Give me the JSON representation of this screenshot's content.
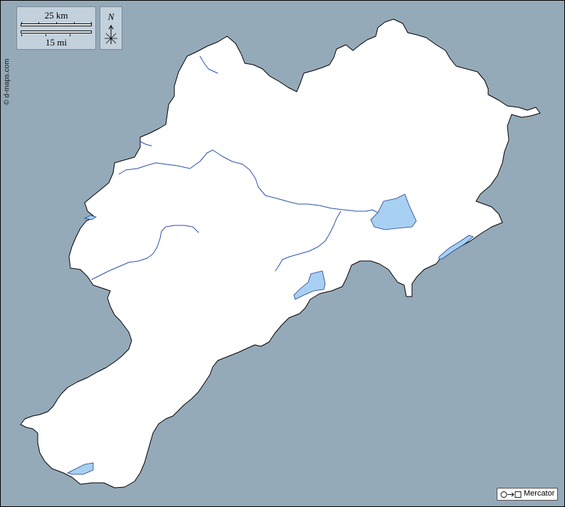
{
  "credit": {
    "text": "© d-maps.com"
  },
  "scale": {
    "km_label": "25 km",
    "mi_label": "15 mi"
  },
  "compass": {
    "north_label": "N"
  },
  "projection": {
    "label": "Mercator"
  },
  "colors": {
    "sea": "#94aab9",
    "land": "#ffffff",
    "lake_fill": "#a8d0f2",
    "river": "#2a4fb0",
    "panel": "#c3d1dd"
  },
  "map": {
    "features": [
      "region-outline",
      "rivers",
      "lakes"
    ],
    "rivers": 7,
    "lakes": 4
  }
}
